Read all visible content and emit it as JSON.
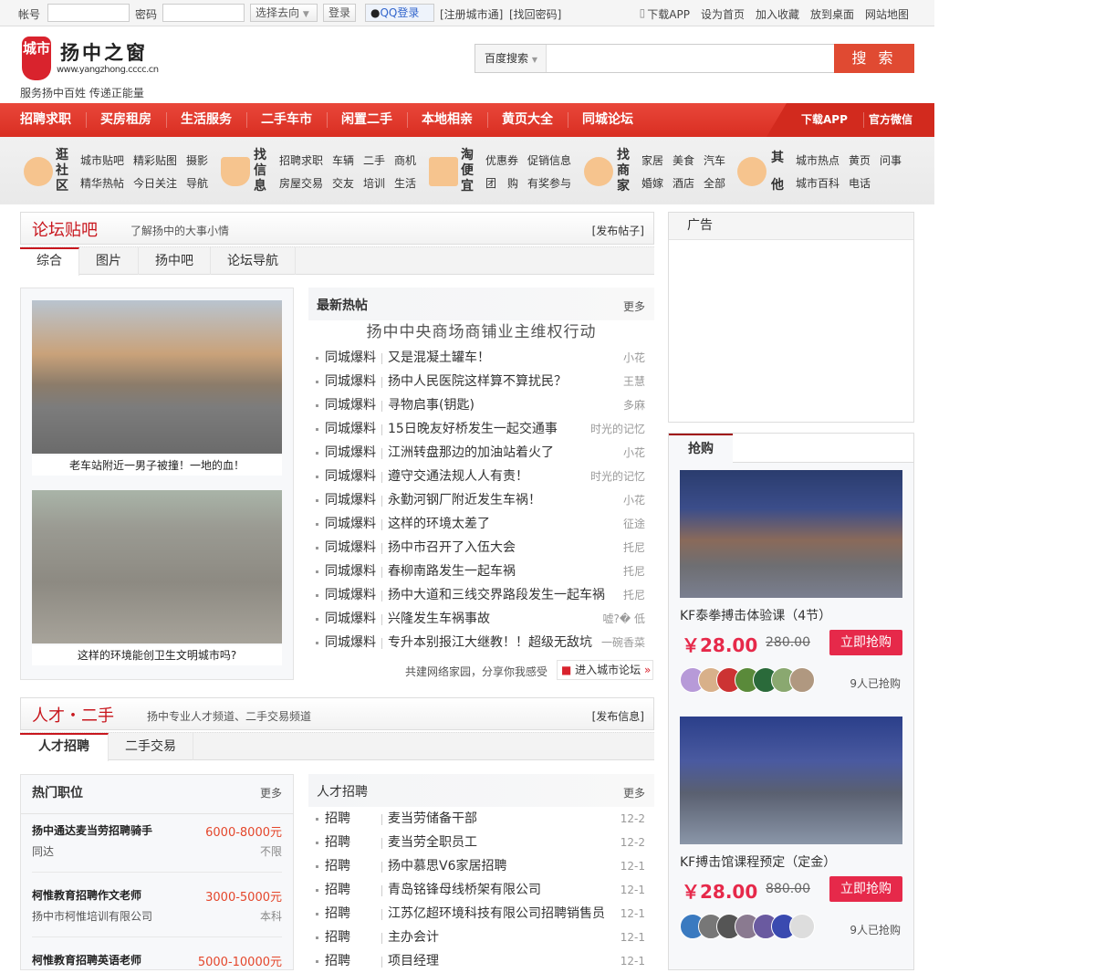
{
  "topbar": {
    "account_label": "帐号",
    "password_label": "密码",
    "direction_select": "选择去向",
    "login": "登录",
    "qq_login": "QQ登录",
    "register": "[注册城市通]",
    "recover": "[找回密码]",
    "links": [
      "下载APP",
      "设为首页",
      "加入收藏",
      "放到桌面",
      "网站地图"
    ]
  },
  "header": {
    "logo_text": "城市",
    "site_name": "扬中之窗",
    "site_url": "www.yangzhong.cccc.cn",
    "slogan": "服务扬中百姓 传递正能量",
    "search_engine": "百度搜索",
    "search_placeholder": "",
    "search_button": "搜 索"
  },
  "nav": {
    "items": [
      "招聘求职",
      "买房租房",
      "生活服务",
      "二手车市",
      "闲置二手",
      "本地相亲",
      "黄页大全",
      "同城论坛"
    ],
    "right": [
      "下载APP",
      "官方微信"
    ]
  },
  "categories": [
    {
      "title": "逛社区",
      "links": [
        "城市贴吧",
        "精彩贴图",
        "摄影",
        "精华热帖",
        "今日关注",
        "导航"
      ]
    },
    {
      "title": "找信息",
      "links": [
        "招聘求职",
        "车辆",
        "二手",
        "商机",
        "房屋交易",
        "交友",
        "培训",
        "生活"
      ]
    },
    {
      "title": "淘便宜",
      "links": [
        "优惠券",
        "促销信息",
        "团　购",
        "有奖参与"
      ]
    },
    {
      "title": "找商家",
      "links": [
        "家居",
        "美食",
        "汽车",
        "婚嫁",
        "酒店",
        "全部"
      ]
    },
    {
      "title": "其他",
      "links": [
        "城市热点",
        "黄页",
        "问事",
        "城市百科",
        "电话"
      ]
    }
  ],
  "forum": {
    "title": "论坛贴吧",
    "desc": "了解扬中的大事小情",
    "action": "[发布帖子]",
    "tabs": [
      "综合",
      "图片",
      "扬中吧",
      "论坛导航"
    ],
    "pics": [
      {
        "caption": "老车站附近一男子被撞！一地的血！"
      },
      {
        "caption": "这样的环境能创卫生文明城市吗?"
      }
    ],
    "list_title": "最新热帖",
    "more": "更多",
    "headline": "扬中中央商场商铺业主维权行动",
    "posts": [
      {
        "cat": "同城爆料",
        "title": "又是混凝土罐车！",
        "author": "小花"
      },
      {
        "cat": "同城爆料",
        "title": "扬中人民医院这样算不算扰民？",
        "author": "王慧"
      },
      {
        "cat": "同城爆料",
        "title": "寻物启事(钥匙)",
        "author": "多麻"
      },
      {
        "cat": "同城爆料",
        "title": "15日晚友好桥发生一起交通事",
        "author": "时光的记忆"
      },
      {
        "cat": "同城爆料",
        "title": "江洲转盘那边的加油站着火了",
        "author": "小花"
      },
      {
        "cat": "同城爆料",
        "title": "遵守交通法规人人有责！",
        "author": "时光的记忆"
      },
      {
        "cat": "同城爆料",
        "title": "永勤河钢厂附近发生车祸！",
        "author": "小花"
      },
      {
        "cat": "同城爆料",
        "title": "这样的环境太差了",
        "author": "征途"
      },
      {
        "cat": "同城爆料",
        "title": "扬中市召开了入伍大会",
        "author": "托尼"
      },
      {
        "cat": "同城爆料",
        "title": "春柳南路发生一起车祸",
        "author": "托尼"
      },
      {
        "cat": "同城爆料",
        "title": "扬中大道和三线交界路段发生一起车祸",
        "author": "托尼"
      },
      {
        "cat": "同城爆料",
        "title": "兴隆发生车祸事故",
        "author": "嘘?� 低"
      },
      {
        "cat": "同城爆料",
        "title": "专升本别报江大继教！！超级无敌坑",
        "author": "一碗香菜"
      }
    ],
    "footer_text": "共建网络家园，分享你我感受",
    "enter_button": "进入城市论坛"
  },
  "talent": {
    "title": "人才・二手",
    "desc": "扬中专业人才频道、二手交易频道",
    "action": "[发布信息]",
    "tabs": [
      "人才招聘",
      "二手交易"
    ],
    "hot_title": "热门职位",
    "more": "更多",
    "jobs": [
      {
        "name": "扬中通达麦当劳招聘骑手",
        "salary": "6000-8000元",
        "company": "同达",
        "edu": "不限"
      },
      {
        "name": "柯惟教育招聘作文老师",
        "salary": "3000-5000元",
        "company": "扬中市柯惟培训有限公司",
        "edu": "本科"
      },
      {
        "name": "柯惟教育招聘英语老师",
        "salary": "5000-10000元"
      }
    ],
    "list_title": "人才招聘",
    "posts": [
      {
        "cat": "招聘",
        "title": "麦当劳储备干部",
        "date": "12-2"
      },
      {
        "cat": "招聘",
        "title": "麦当劳全职员工",
        "date": "12-2"
      },
      {
        "cat": "招聘",
        "title": "扬中慕思V6家居招聘",
        "date": "12-1"
      },
      {
        "cat": "招聘",
        "title": "青岛铭锋母线桥架有限公司",
        "date": "12-1"
      },
      {
        "cat": "招聘",
        "title": "江苏亿超环境科技有限公司招聘销售员",
        "date": "12-1"
      },
      {
        "cat": "招聘",
        "title": "主办会计",
        "date": "12-1"
      },
      {
        "cat": "招聘",
        "title": "项目经理",
        "date": "12-1"
      }
    ]
  },
  "ad": {
    "title": "广告"
  },
  "buy": {
    "title": "抢购",
    "items": [
      {
        "name": "KF泰拳搏击体验课（4节）",
        "price": "￥28.00",
        "old_price": "280.00",
        "button": "立即抢购",
        "count": "9人已抢购"
      },
      {
        "name": "KF搏击馆课程预定（定金）",
        "price": "￥28.00",
        "old_price": "880.00",
        "button": "立即抢购",
        "count": "9人已抢购"
      }
    ]
  },
  "colors": {
    "brand_red": "#d9232d",
    "price_red": "#e6294a",
    "salary": "#e4462b"
  }
}
